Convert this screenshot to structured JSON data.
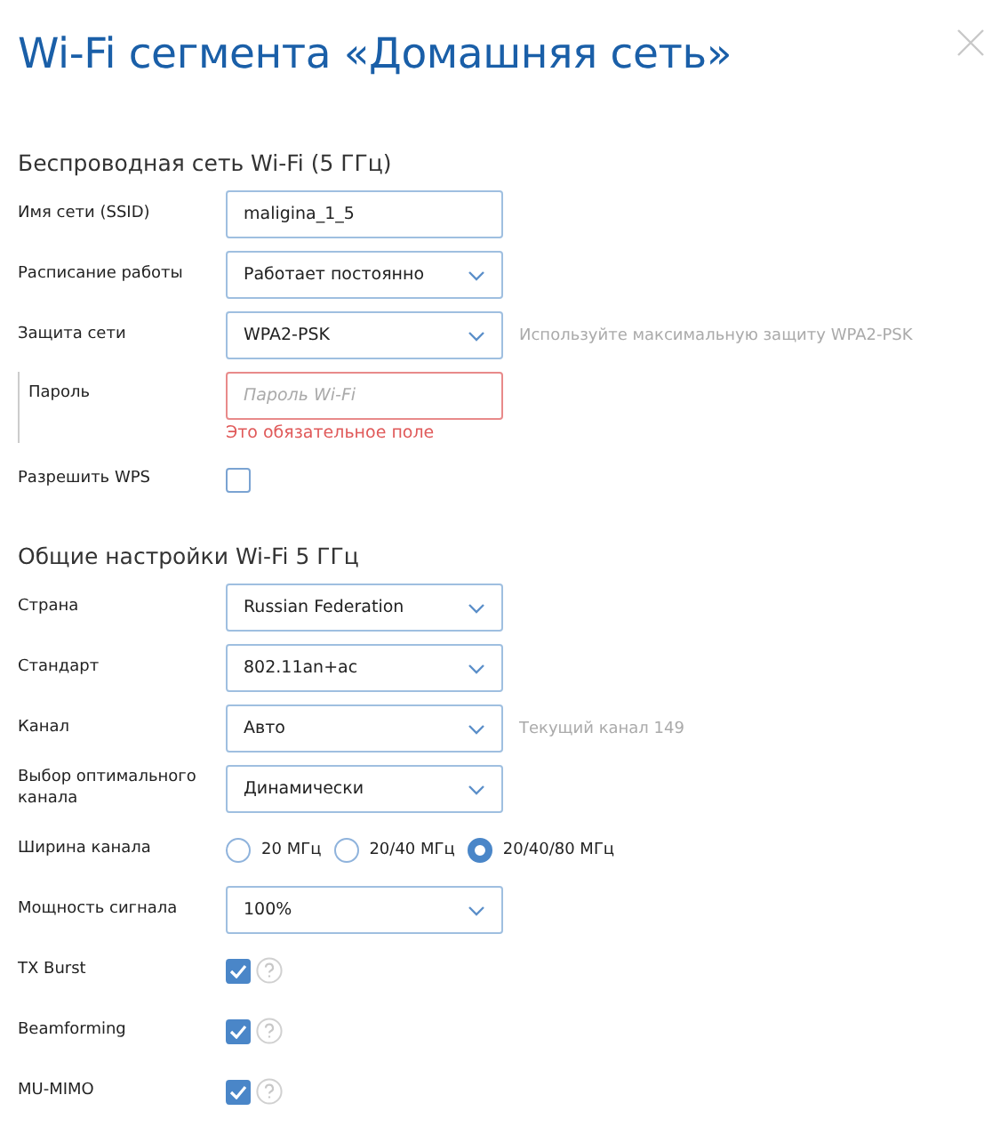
{
  "title": "Wi-Fi сегмента «Домашняя сеть»",
  "sections": [
    {
      "heading": "Беспроводная сеть Wi-Fi (5 ГГц)",
      "rows": [
        {
          "kind": "text",
          "label": "Имя сети (SSID)",
          "value": "maligina_1_5"
        },
        {
          "kind": "select",
          "label": "Расписание работы",
          "value": "Работает постоянно"
        },
        {
          "kind": "select",
          "label": "Защита сети",
          "value": "WPA2-PSK",
          "note": "Используйте максимальную защиту WPA2-PSK"
        },
        {
          "kind": "password",
          "label": "Пароль",
          "placeholder": "Пароль Wi-Fi",
          "error": "Это обязательное поле"
        },
        {
          "kind": "checkbox",
          "label": "Разрешить WPS",
          "checked": false
        }
      ]
    },
    {
      "heading": "Общие настройки Wi-Fi 5 ГГц",
      "rows": [
        {
          "kind": "select",
          "label": "Страна",
          "value": "Russian Federation"
        },
        {
          "kind": "select",
          "label": "Стандарт",
          "value": "802.11an+ac"
        },
        {
          "kind": "select",
          "label": "Канал",
          "value": "Авто",
          "note": "Текущий канал 149"
        },
        {
          "kind": "select",
          "label": "Выбор оптимального канала",
          "value": "Динамически"
        },
        {
          "kind": "radio",
          "label": "Ширина канала",
          "options": [
            {
              "label": "20 МГц",
              "selected": false
            },
            {
              "label": "20/40 МГц",
              "selected": false
            },
            {
              "label": "20/40/80 МГц",
              "selected": true
            }
          ]
        },
        {
          "kind": "select",
          "label": "Мощность сигнала",
          "value": "100%"
        },
        {
          "kind": "checkbox-help",
          "label": "TX Burst",
          "checked": true
        },
        {
          "kind": "checkbox-help",
          "label": "Beamforming",
          "checked": true
        },
        {
          "kind": "checkbox-help",
          "label": "MU-MIMO",
          "checked": true
        }
      ]
    }
  ]
}
